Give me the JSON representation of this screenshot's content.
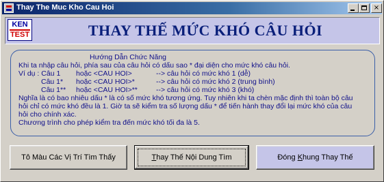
{
  "window": {
    "title": "Thay The Muc Kho Cau Hoi",
    "minimize_label": "_",
    "close_label": "×"
  },
  "logo": {
    "line1": "KEN",
    "line2": "TEST"
  },
  "header": {
    "title": "THAY THẾ MỨC KHÓ CÂU HỎI"
  },
  "guide": {
    "title": "Hướng Dẫn Chức Năng",
    "intro": "Khi ta nhập câu hỏi, phía sau của câu hỏi có dấu sao * đại diện cho mức khó câu hỏi.",
    "examples": [
      {
        "col1": "Ví dụ : Câu 1",
        "col2": "hoặc <CAU HOI>",
        "col3": "--> câu hỏi có mức khó 1 (dễ)"
      },
      {
        "col1": "Câu 1*",
        "col2": "hoặc <CAU HOI>*",
        "col3": "--> câu hỏi có mức khó 2 (trung bình)"
      },
      {
        "col1": "Câu 1**",
        "col2": "hoặc <CAU HOI>**",
        "col3": "--> câu hỏi có mức khó 3 (khó)"
      }
    ],
    "paragraph_lines": [
      "Nghĩa là có bao nhiêu dấu * là có số mức khó tương ứng. Tuy nhiên khi ta chèn mặc định thì toàn bộ câu",
      "hỏi chỉ có mức khó đều là 1. Giờ ta sẽ kiểm tra số lượng dấu * để tiến hành thay đổi lại mức khó của câu",
      "hỏi cho chính xác."
    ],
    "closing": "Chương trình cho phép kiểm tra đến mức khó tối đa là 5."
  },
  "buttons": {
    "highlight": "Tô Màu Các Vị Trí Tìm Thấy",
    "replace_prefix": "T",
    "replace_rest": "hay Thế Nội Dung Tìm",
    "close_prefix": "Đóng ",
    "close_mnemonic": "K",
    "close_rest": "hung Thay Thế"
  },
  "colors": {
    "header_bg": "#c5c5e8",
    "title_text": "#0a1f7a",
    "guide_text": "#10108a",
    "guide_border": "#3a5ea8"
  }
}
